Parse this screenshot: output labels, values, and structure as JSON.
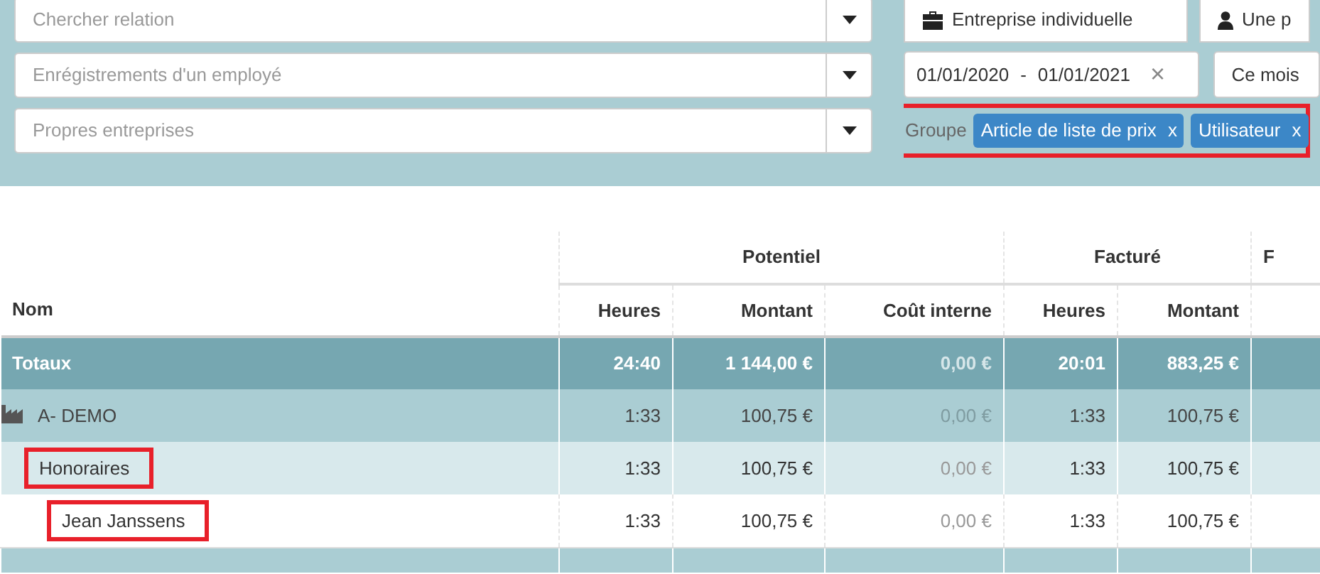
{
  "filters": {
    "selects": [
      {
        "placeholder": "Chercher relation"
      },
      {
        "placeholder": "Enrégistrements d'un employé"
      },
      {
        "placeholder": "Propres entreprises"
      }
    ],
    "type_buttons": [
      {
        "label": "Entreprise individuelle"
      },
      {
        "label": "Une p"
      }
    ],
    "date_range": {
      "start": "01/01/2020",
      "separator": "-",
      "end": "01/01/2021",
      "clear": "×"
    },
    "period": {
      "value": "Ce mois"
    },
    "group": {
      "label": "Groupe",
      "highlighted": true,
      "tags": [
        {
          "label": "Article de liste de prix",
          "remove": "x"
        },
        {
          "label": "Utilisateur",
          "remove": "x"
        }
      ]
    }
  },
  "table": {
    "name_column": "Nom",
    "groups": [
      {
        "label": "Potentiel",
        "columns": [
          "Heures",
          "Montant",
          "Coût interne"
        ]
      },
      {
        "label": "Facturé",
        "columns": [
          "Heures",
          "Montant"
        ]
      },
      {
        "label": "F"
      }
    ],
    "totals": {
      "label": "Totaux",
      "cells": [
        {
          "text": "24:40",
          "muted": false
        },
        {
          "text": "1 144,00 €",
          "muted": false
        },
        {
          "text": "0,00 €",
          "muted": true
        },
        {
          "text": "20:01",
          "muted": false
        },
        {
          "text": "883,25 €",
          "muted": false
        }
      ]
    },
    "rows": [
      {
        "name": "A- DEMO",
        "highlighted": false,
        "cells": [
          {
            "text": "1:33",
            "muted": false
          },
          {
            "text": "100,75 €",
            "muted": false
          },
          {
            "text": "0,00 €",
            "muted": true
          },
          {
            "text": "1:33",
            "muted": false
          },
          {
            "text": "100,75 €",
            "muted": false
          }
        ],
        "children": [
          {
            "name": "Honoraires",
            "highlighted": true,
            "cells": [
              {
                "text": "1:33",
                "muted": false
              },
              {
                "text": "100,75 €",
                "muted": false
              },
              {
                "text": "0,00 €",
                "muted": true
              },
              {
                "text": "1:33",
                "muted": false
              },
              {
                "text": "100,75 €",
                "muted": false
              }
            ],
            "children": [
              {
                "name": "Jean Janssens",
                "highlighted": true,
                "cells": [
                  {
                    "text": "1:33",
                    "muted": false
                  },
                  {
                    "text": "100,75 €",
                    "muted": false
                  },
                  {
                    "text": "0,00 €",
                    "muted": true
                  },
                  {
                    "text": "1:33",
                    "muted": false
                  },
                  {
                    "text": "100,75 €",
                    "muted": false
                  }
                ]
              }
            ]
          }
        ]
      }
    ]
  }
}
